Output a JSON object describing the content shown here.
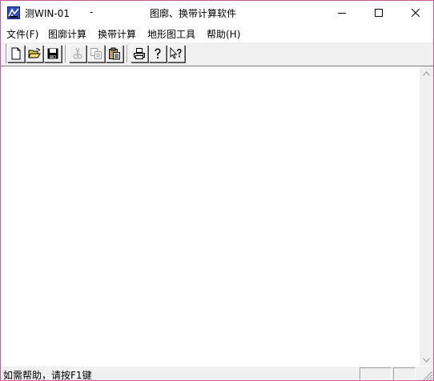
{
  "titlebar": {
    "app_name": "测WIN-01",
    "separator": "-",
    "document_title": "图廓、换带计算软件"
  },
  "window_buttons": {
    "minimize_icon": "minimize-icon",
    "maximize_icon": "maximize-icon",
    "close_icon": "close-icon"
  },
  "menu": {
    "items": [
      {
        "label": "文件(F)"
      },
      {
        "label": "图廓计算"
      },
      {
        "label": "换带计算"
      },
      {
        "label": "地形图工具"
      },
      {
        "label": "帮助(H)"
      }
    ]
  },
  "toolbar": {
    "buttons": [
      {
        "icon": "new-file-icon",
        "enabled": true
      },
      {
        "icon": "open-folder-icon",
        "enabled": true
      },
      {
        "icon": "save-icon",
        "enabled": true
      },
      {
        "icon": "cut-icon",
        "enabled": false
      },
      {
        "icon": "copy-icon",
        "enabled": false
      },
      {
        "icon": "paste-icon",
        "enabled": true
      },
      {
        "icon": "print-icon",
        "enabled": true
      },
      {
        "icon": "help-icon",
        "enabled": true
      },
      {
        "icon": "context-help-icon",
        "enabled": true
      }
    ]
  },
  "status": {
    "text": "如需帮助，请按F1键"
  },
  "colors": {
    "window_border": "#c25aa0",
    "chrome": "#f0f0f0",
    "client": "#ffffff"
  }
}
